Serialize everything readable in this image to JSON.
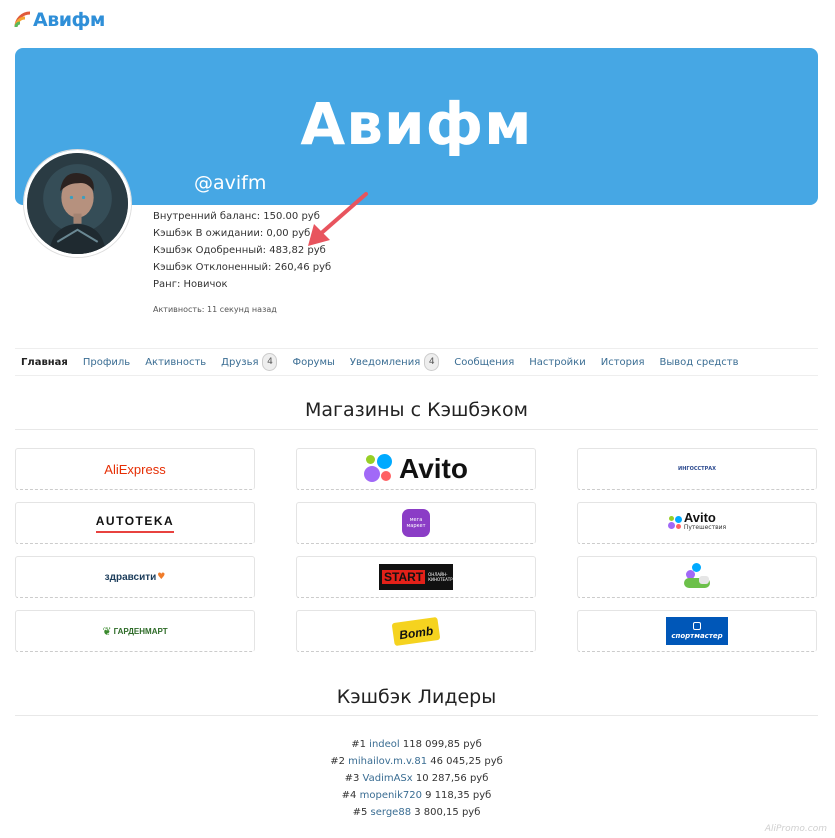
{
  "site": {
    "logo_text": "Авифм"
  },
  "cover": {
    "title": "Авифм"
  },
  "profile": {
    "username": "@avifm",
    "stats": [
      "Внутренний баланс: 150.00 руб",
      "Кэшбэк В ожидании: 0,00 руб",
      "Кэшбэк Одобренный: 483,82 руб",
      "Кэшбэк Отклоненный: 260,46 руб",
      "Ранг: Новичок"
    ],
    "activity": "Активность: 11 секунд назад"
  },
  "nav": {
    "items": [
      {
        "label": "Главная"
      },
      {
        "label": "Профиль"
      },
      {
        "label": "Активность"
      },
      {
        "label": "Друзья",
        "badge": "4"
      },
      {
        "label": "Форумы"
      },
      {
        "label": "Уведомления",
        "badge": "4"
      },
      {
        "label": "Сообщения"
      },
      {
        "label": "Настройки"
      },
      {
        "label": "История"
      },
      {
        "label": "Вывод средств"
      }
    ]
  },
  "shops": {
    "title": "Магазины с Кэшбэком",
    "items": [
      {
        "logo_text": "AliExpress",
        "icon": "aliexpress-logo"
      },
      {
        "logo_text": "Avito",
        "icon": "avito-logo"
      },
      {
        "logo_text": "ИНГОССТРАХ",
        "icon": "ingosstrakh-logo"
      },
      {
        "logo_text": "AUTOTEKA",
        "icon": "autoteka-logo"
      },
      {
        "logo_text": "мега маркет",
        "icon": "megamarket-logo"
      },
      {
        "logo_text": "Avito",
        "logo_sub": "Путешествия",
        "icon": "avito-travel-logo"
      },
      {
        "logo_text": "здравсити",
        "icon": "zdravcity-logo"
      },
      {
        "logo_text": "START",
        "logo_sub": "ОНЛАЙН-КИНОТЕАТР",
        "icon": "start-logo"
      },
      {
        "logo_text": "",
        "icon": "avito-auto-logo"
      },
      {
        "logo_text": "ГАРДЕНМАРТ",
        "icon": "gardenmart-logo"
      },
      {
        "logo_text": "Bomb",
        "icon": "bomb-logo"
      },
      {
        "logo_text": "спортмастер",
        "icon": "sportmaster-logo"
      }
    ]
  },
  "leaders": {
    "title": "Кэшбэк Лидеры",
    "rows": [
      {
        "rank": "#1",
        "name": "indeol",
        "amount": "118 099,85 руб"
      },
      {
        "rank": "#2",
        "name": "mihailov.m.v.81",
        "amount": "46 045,25 руб"
      },
      {
        "rank": "#3",
        "name": "VadimASx",
        "amount": "10 287,56 руб"
      },
      {
        "rank": "#4",
        "name": "mopenik720",
        "amount": "9 118,35 руб"
      },
      {
        "rank": "#5",
        "name": "serge88",
        "amount": "3 800,15 руб"
      }
    ]
  },
  "watermark": "AliPromo.com",
  "colors": {
    "cover": "#46a7e4",
    "link": "#3a6d93",
    "arrow": "#e8545e"
  }
}
